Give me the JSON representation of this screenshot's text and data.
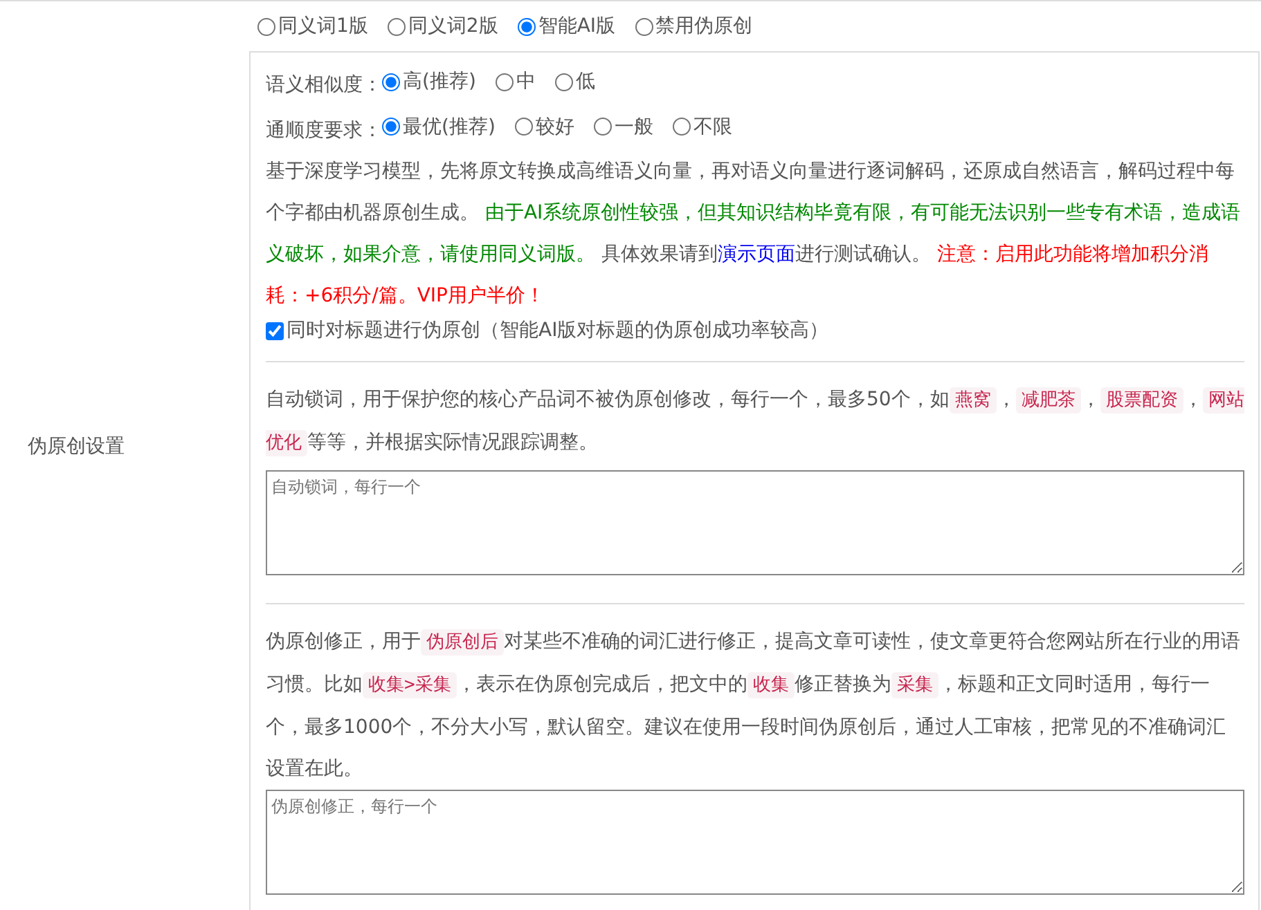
{
  "modes": [
    {
      "label": "同义词1版",
      "selected": false
    },
    {
      "label": "同义词2版",
      "selected": false
    },
    {
      "label": "智能AI版",
      "selected": true
    },
    {
      "label": "禁用伪原创",
      "selected": false
    }
  ],
  "settings_label": "伪原创设置",
  "similarity": {
    "label": "语义相似度：",
    "options": [
      {
        "label": "高(推荐)",
        "selected": true
      },
      {
        "label": "中",
        "selected": false
      },
      {
        "label": "低",
        "selected": false
      }
    ]
  },
  "fluency": {
    "label": "通顺度要求：",
    "options": [
      {
        "label": "最优(推荐)",
        "selected": true
      },
      {
        "label": "较好",
        "selected": false
      },
      {
        "label": "一般",
        "selected": false
      },
      {
        "label": "不限",
        "selected": false
      }
    ]
  },
  "description": [
    {
      "kind": "text",
      "text": "基于深度学习模型，先将原文转换成高维语义向量，再对语义向量进行逐词解码，还原成自然语言，解码过程中每个字都由机器原创生成。 "
    },
    {
      "kind": "success",
      "text": "由于AI系统原创性较强，但其知识结构毕竟有限，有可能无法识别一些专有术语，造成语义破坏，如果介意，请使用同义词版。"
    },
    {
      "kind": "text",
      "text": " 具体效果请到"
    },
    {
      "kind": "link",
      "text": "演示页面"
    },
    {
      "kind": "text",
      "text": "进行测试确认。 "
    },
    {
      "kind": "warning",
      "text": "注意：启用此功能将增加积分消耗：+6积分/篇。VIP用户半价！"
    }
  ],
  "title_checkbox": {
    "label": "同时对标题进行伪原创（智能AI版对标题的伪原创成功率较高）",
    "checked": true
  },
  "lock_words": {
    "description": [
      {
        "kind": "text",
        "text": "自动锁词，用于保护您的核心产品词不被伪原创修改，每行一个，最多50个，如"
      },
      {
        "kind": "code",
        "text": "燕窝"
      },
      {
        "kind": "text",
        "text": "，"
      },
      {
        "kind": "code",
        "text": "减肥茶"
      },
      {
        "kind": "text",
        "text": "，"
      },
      {
        "kind": "code",
        "text": "股票配资"
      },
      {
        "kind": "text",
        "text": "，"
      },
      {
        "kind": "code",
        "text": "网站优化"
      },
      {
        "kind": "text",
        "text": "等等，并根据实际情况跟踪调整。"
      }
    ],
    "placeholder": "自动锁词，每行一个"
  },
  "correction": {
    "description": [
      {
        "kind": "text",
        "text": "伪原创修正，用于"
      },
      {
        "kind": "code",
        "text": "伪原创后"
      },
      {
        "kind": "text",
        "text": "对某些不准确的词汇进行修正，提高文章可读性，使文章更符合您网站所在行业的用语习惯。比如"
      },
      {
        "kind": "code",
        "text": "收集>采集"
      },
      {
        "kind": "text",
        "text": "，表示在伪原创完成后，把文中的"
      },
      {
        "kind": "code",
        "text": "收集"
      },
      {
        "kind": "text",
        "text": "修正替换为"
      },
      {
        "kind": "code",
        "text": "采集"
      },
      {
        "kind": "text",
        "text": "，标题和正文同时适用，每行一个，最多1000个，不分大小写，默认留空。建议在使用一段时间伪原创后，通过人工审核，把常见的不准确词汇设置在此。"
      }
    ],
    "placeholder": "伪原创修正，每行一个"
  }
}
